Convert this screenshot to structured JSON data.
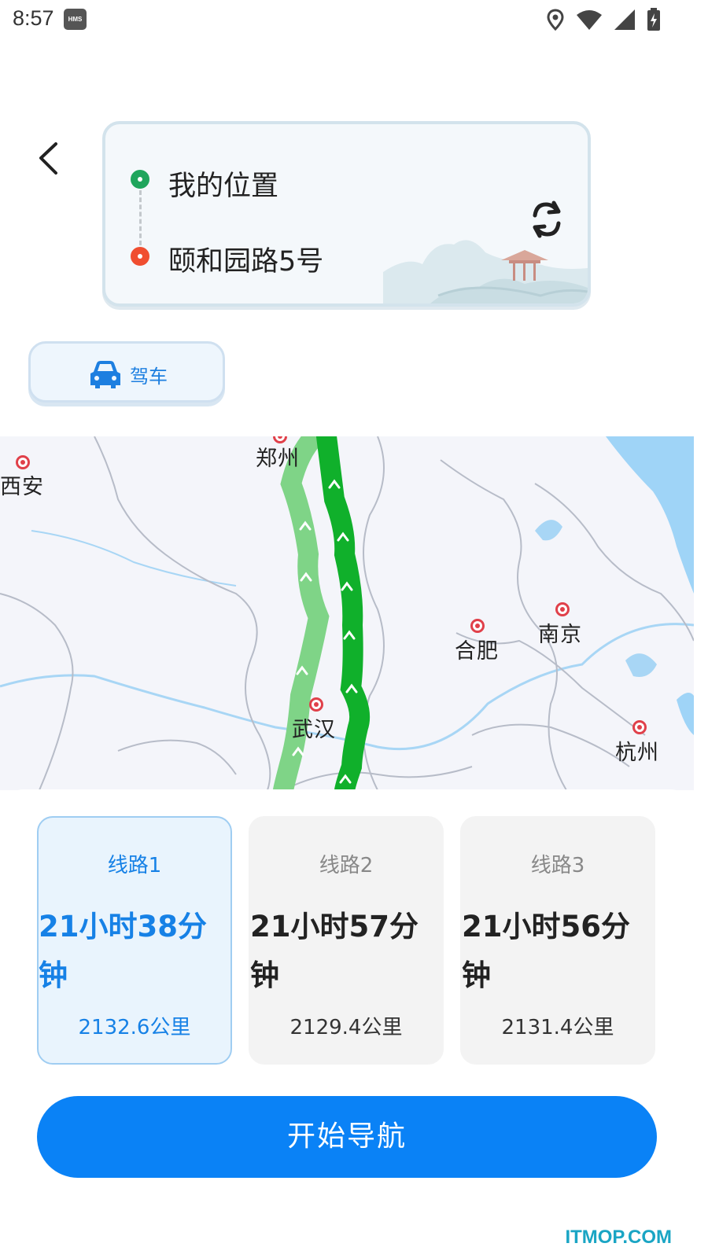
{
  "status_bar": {
    "time": "8:57",
    "hms_badge": "HMS",
    "icons": [
      "location-icon",
      "wifi-icon",
      "signal-icon",
      "battery-charging-icon"
    ]
  },
  "header": {
    "back_icon": "chevron-left-icon",
    "origin": "我的位置",
    "destination": "颐和园路5号",
    "swap_icon": "swap-icon"
  },
  "travel_mode": {
    "label": "驾车",
    "icon": "car-icon"
  },
  "map": {
    "cities": [
      "郑州",
      "西安",
      "合肥",
      "南京",
      "武汉",
      "杭州"
    ]
  },
  "routes": [
    {
      "label": "线路1",
      "time": "21小时38分钟",
      "distance": "2132.6公里",
      "selected": true
    },
    {
      "label": "线路2",
      "time": "21小时57分钟",
      "distance": "2129.4公里",
      "selected": false
    },
    {
      "label": "线路3",
      "time": "21小时56分钟",
      "distance": "2131.4公里",
      "selected": false
    }
  ],
  "start_button": "开始导航",
  "watermark": "ITMOP.COM",
  "colors": {
    "accent": "#0a82f6",
    "route_selected": "#10b02b",
    "route_alt": "#7fd487",
    "origin_dot": "#1fa55c",
    "destination_dot": "#f04e30"
  }
}
